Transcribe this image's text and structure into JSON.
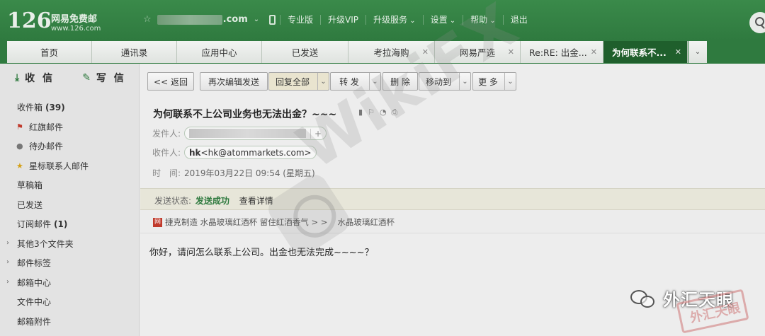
{
  "header": {
    "logo_number": "126",
    "logo_name": "网易免费邮",
    "logo_url": "www.126.com",
    "account_domain": ".com",
    "nav": [
      "专业版",
      "升级VIP",
      "升级服务",
      "设置",
      "帮助",
      "退出"
    ]
  },
  "tabs": [
    {
      "label": "首页",
      "closable": false,
      "active": false
    },
    {
      "label": "通讯录",
      "closable": false,
      "active": false
    },
    {
      "label": "应用中心",
      "closable": false,
      "active": false
    },
    {
      "label": "已发送",
      "closable": false,
      "active": false
    },
    {
      "label": "考拉海购",
      "closable": true,
      "active": false
    },
    {
      "label": "网易严选",
      "closable": true,
      "active": false
    },
    {
      "label": "Re:RE: 出金...",
      "closable": true,
      "active": false
    },
    {
      "label": "为何联系不...",
      "closable": true,
      "active": true
    }
  ],
  "sidebar": {
    "receive_label": "收 信",
    "compose_label": "写 信",
    "folders": [
      {
        "label": "收件箱",
        "count": "(39)"
      },
      {
        "label": "红旗邮件",
        "icon": "red-flag-icon"
      },
      {
        "label": "待办邮件",
        "icon": "clock-icon"
      },
      {
        "label": "星标联系人邮件",
        "icon": "star-icon"
      },
      {
        "label": "草稿箱"
      },
      {
        "label": "已发送"
      },
      {
        "label": "订阅邮件",
        "count": "(1)"
      },
      {
        "label": "其他3个文件夹",
        "expandable": true
      },
      {
        "label": "邮件标签",
        "expandable": true
      },
      {
        "label": "邮箱中心",
        "expandable": true
      },
      {
        "label": "文件中心"
      },
      {
        "label": "邮箱附件"
      }
    ]
  },
  "toolbar": {
    "back": "<< 返回",
    "re_edit": "再次编辑发送",
    "reply_all": "回复全部",
    "forward": "转 发",
    "delete": "删 除",
    "move_to": "移动到",
    "more": "更 多"
  },
  "message": {
    "subject": "为何联系不上公司业务也无法出金？~~~",
    "from_label": "发件人:",
    "to_label": "收件人:",
    "to_name": "hk",
    "to_email": "<hk@atommarkets.com>",
    "time_label": "时　间:",
    "time_value": "2019年03月22日 09:54 (星期五)",
    "status_label": "发送状态:",
    "status_value": "发送成功",
    "status_link": "查看详情",
    "ad_badge": "网",
    "ad_text_1": "捷克制造 水晶玻璃红酒杯 留住红酒香气 > >",
    "ad_text_2": "水晶玻璃红酒杯",
    "body": "你好，请问怎么联系上公司。出金也无法完成~~~~？"
  },
  "watermarks": {
    "wikifx": "WikiFX",
    "wechat_name": "外汇天眼",
    "stamp": "外汇天眼"
  }
}
